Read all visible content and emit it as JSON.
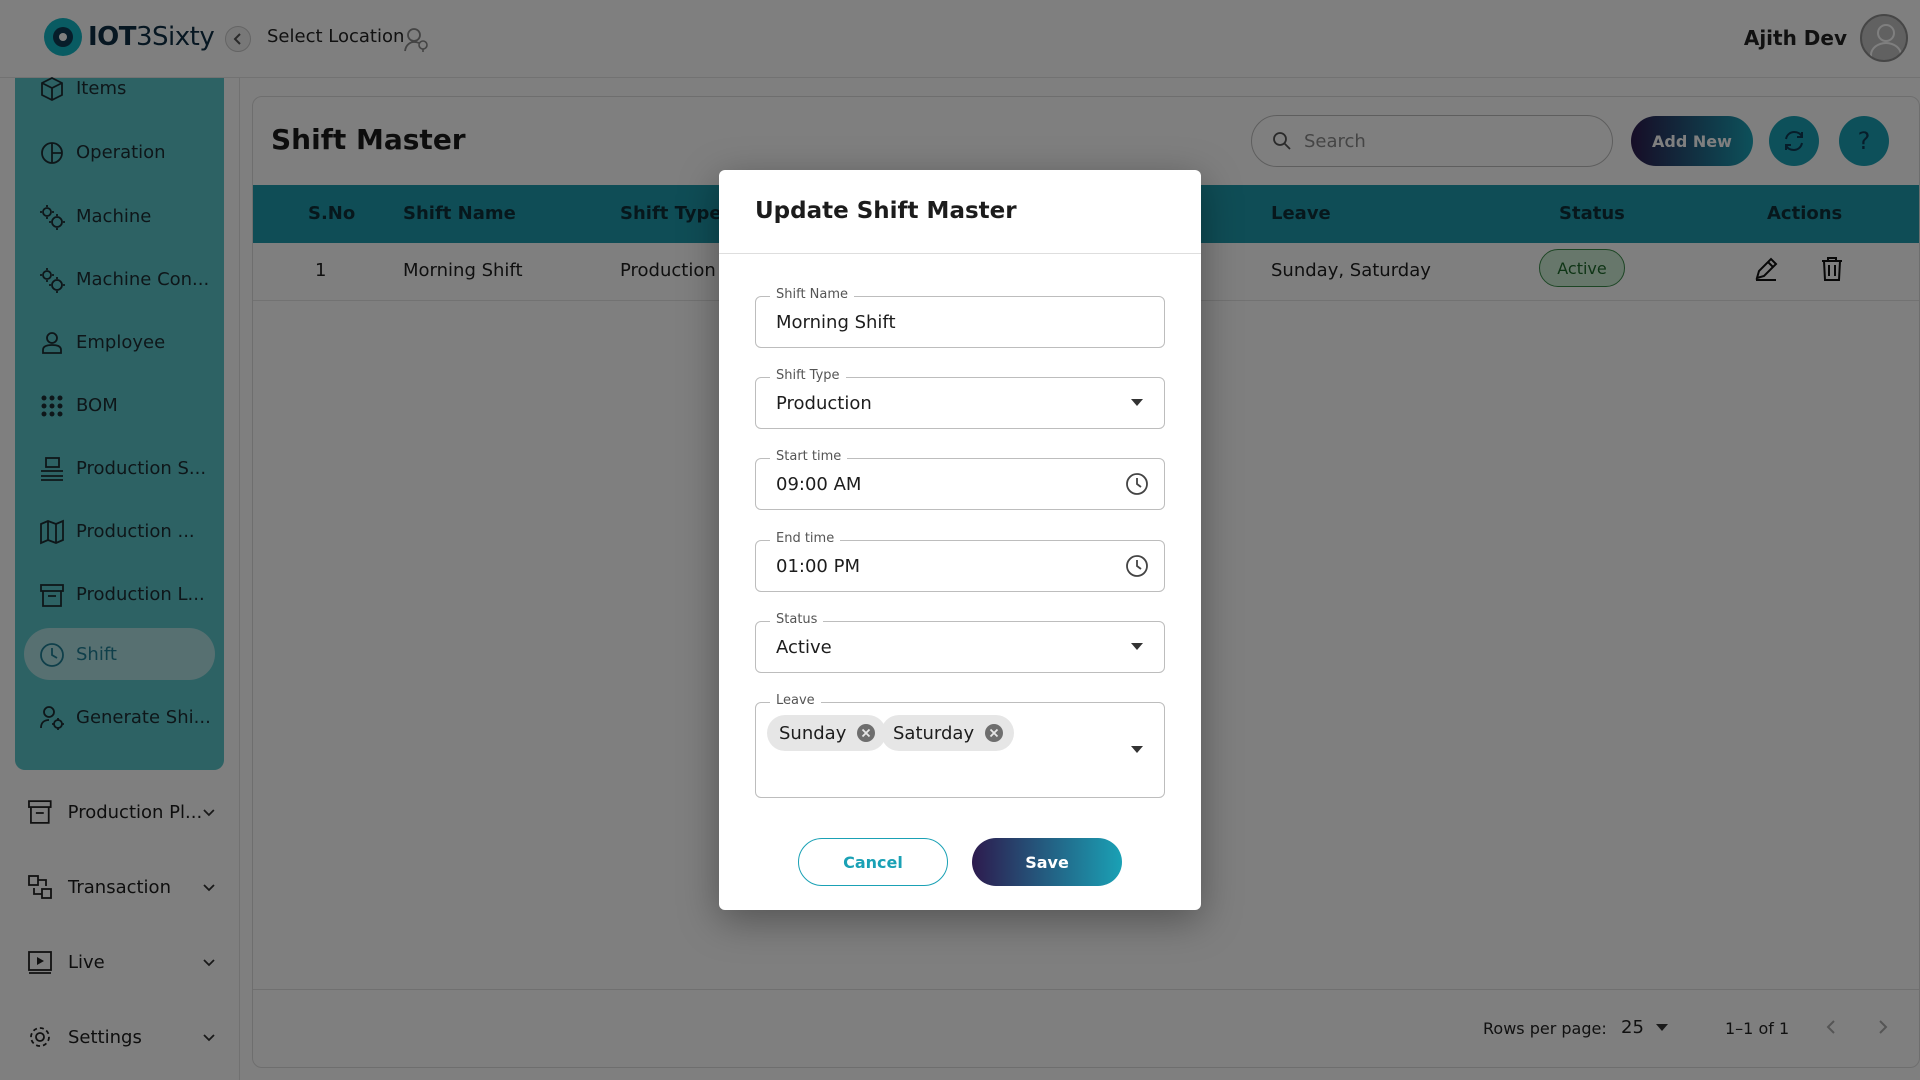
{
  "app": {
    "logo_bold": "IOT",
    "logo_rest": "3Sixty"
  },
  "header": {
    "location_label": "Select Location",
    "username": "Ajith Dev"
  },
  "sidebar": {
    "sub_items": [
      {
        "label": "Items",
        "icon": "cube-icon"
      },
      {
        "label": "Operation",
        "icon": "pie-icon"
      },
      {
        "label": "Machine",
        "icon": "gears-icon"
      },
      {
        "label": "Machine Con...",
        "icon": "gears-icon"
      },
      {
        "label": "Employee",
        "icon": "person-icon"
      },
      {
        "label": "BOM",
        "icon": "grid-dots-icon"
      },
      {
        "label": "Production S...",
        "icon": "stack-icon"
      },
      {
        "label": "Production ...",
        "icon": "map-icon"
      },
      {
        "label": "Production L...",
        "icon": "archive-icon"
      },
      {
        "label": "Shift",
        "icon": "clock-icon"
      },
      {
        "label": "Generate Shi...",
        "icon": "person-gear-icon"
      }
    ],
    "main_items": [
      {
        "label": "Production Pl...",
        "icon": "archive-icon"
      },
      {
        "label": "Transaction",
        "icon": "transaction-icon"
      },
      {
        "label": "Live",
        "icon": "play-icon"
      },
      {
        "label": "Settings",
        "icon": "gear-icon"
      }
    ]
  },
  "page": {
    "title": "Shift Master",
    "search_placeholder": "Search",
    "add_new_label": "Add New",
    "help_label": "?"
  },
  "table": {
    "columns": [
      "S.No",
      "Shift Name",
      "Shift Type",
      "Leave",
      "Status",
      "Actions"
    ],
    "rows": [
      {
        "sno": "1",
        "shift_name": "Morning Shift",
        "shift_type": "Production",
        "leave": "Sunday, Saturday",
        "status": "Active"
      }
    ]
  },
  "pagination": {
    "rows_label": "Rows per page:",
    "rows_value": "25",
    "range": "1–1 of 1"
  },
  "dialog": {
    "title": "Update Shift Master",
    "fields": {
      "shift_name": {
        "label": "Shift Name",
        "value": "Morning Shift"
      },
      "shift_type": {
        "label": "Shift Type",
        "value": "Production"
      },
      "start_time": {
        "label": "Start time",
        "value": "09:00 AM"
      },
      "end_time": {
        "label": "End time",
        "value": "01:00 PM"
      },
      "status": {
        "label": "Status",
        "value": "Active"
      },
      "leave": {
        "label": "Leave",
        "chips": [
          "Sunday",
          "Saturday"
        ]
      }
    },
    "cancel_label": "Cancel",
    "save_label": "Save"
  },
  "colors": {
    "accent": "#1aa1b5",
    "sidebar_panel": "#5bc4c8",
    "table_header": "#1e9aac",
    "gradient_start": "#2d1b4e",
    "status_active_bg": "#cfeed6"
  }
}
